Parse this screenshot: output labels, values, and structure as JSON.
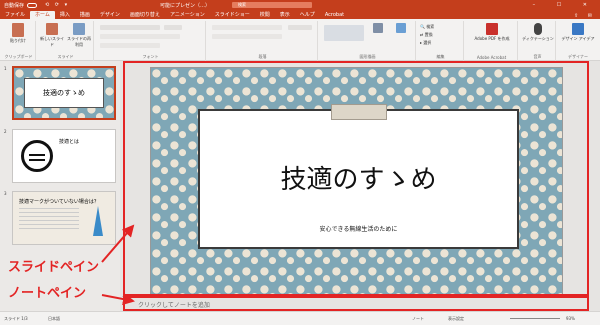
{
  "titlebar": {
    "autosave": "自動保存",
    "doc_title": "可能にプレゼン（…）",
    "search_placeholder": "検索",
    "quick_access": "⟲ ⟳ ▾",
    "window_controls": "– ☐ ✕"
  },
  "tabs": [
    {
      "label": "ファイル"
    },
    {
      "label": "ホーム"
    },
    {
      "label": "挿入"
    },
    {
      "label": "描画"
    },
    {
      "label": "デザイン"
    },
    {
      "label": "画面切り替え"
    },
    {
      "label": "アニメーション"
    },
    {
      "label": "スライドショー"
    },
    {
      "label": "校閲"
    },
    {
      "label": "表示"
    },
    {
      "label": "ヘルプ"
    },
    {
      "label": "Acrobat"
    }
  ],
  "ribbon": {
    "groups": [
      {
        "label": "クリップボード"
      },
      {
        "label": "スライド"
      },
      {
        "label": "フォント"
      },
      {
        "label": "段落"
      },
      {
        "label": "図形描画"
      },
      {
        "label": "編集"
      },
      {
        "label": "Adobe Acrobat"
      },
      {
        "label": "音声"
      },
      {
        "label": "デザイナー"
      }
    ],
    "buttons": {
      "paste": "貼り付け",
      "new_slide": "新しいスライド",
      "reuse_slide": "スライドの再利用",
      "adobe_pdf": "Adobe PDF を作成",
      "dictate": "ディクテーション",
      "design_ideas": "デザイン アイデア",
      "search": "検索",
      "replace": "置換",
      "select": "選択"
    }
  },
  "thumbnails": [
    {
      "number": "1",
      "title": "技適のすゝめ"
    },
    {
      "number": "2",
      "title": "技適とは"
    },
    {
      "number": "3",
      "title": "技適マークがついていない場合は？"
    }
  ],
  "slide": {
    "title": "技適のすゝめ",
    "subtitle": "安心できる無線生活のために"
  },
  "notes": {
    "placeholder": "クリックしてノートを追加"
  },
  "statusbar": {
    "slide_info": "スライド 1/3",
    "language": "日本語",
    "notes_button": "ノート",
    "display_settings": "表示設定",
    "zoom": "93%"
  },
  "annotations": {
    "slide_pane_label": "スライドペイン",
    "notes_pane_label": "ノートペイン",
    "color": "#e32424"
  }
}
